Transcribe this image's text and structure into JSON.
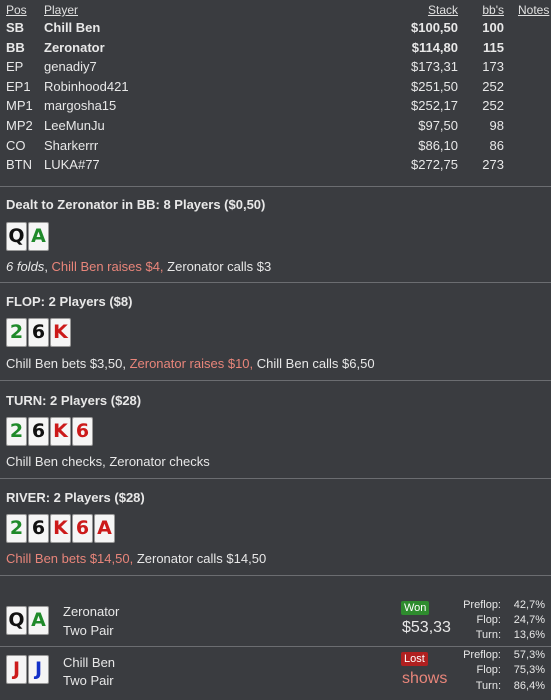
{
  "columns": {
    "pos": "Pos",
    "player": "Player",
    "stack": "Stack",
    "bbs": "bb's",
    "notes": "Notes"
  },
  "players": [
    {
      "pos": "SB",
      "name": "Chill Ben",
      "stack": "$100,50",
      "bb": "100",
      "bold": true
    },
    {
      "pos": "BB",
      "name": "Zeronator",
      "stack": "$114,80",
      "bb": "115",
      "bold": true
    },
    {
      "pos": "EP",
      "name": "genadiy7",
      "stack": "$173,31",
      "bb": "173",
      "bold": false
    },
    {
      "pos": "EP1",
      "name": "Robinhood421",
      "stack": "$251,50",
      "bb": "252",
      "bold": false
    },
    {
      "pos": "MP1",
      "name": "margosha15",
      "stack": "$252,17",
      "bb": "252",
      "bold": false
    },
    {
      "pos": "MP2",
      "name": "LeeMunJu",
      "stack": "$97,50",
      "bb": "98",
      "bold": false
    },
    {
      "pos": "CO",
      "name": "Sharkerrr",
      "stack": "$86,10",
      "bb": "86",
      "bold": false
    },
    {
      "pos": "BTN",
      "name": "LUKA#77",
      "stack": "$272,75",
      "bb": "273",
      "bold": false
    }
  ],
  "preflop": {
    "title": "Dealt to Zeronator in BB: 8 Players ($0,50)",
    "cards": [
      {
        "rank": "Q",
        "suit": "spades"
      },
      {
        "rank": "A",
        "suit": "clubs"
      }
    ],
    "actions": [
      {
        "text": "6 folds",
        "style": "ital"
      },
      {
        "text": ", ",
        "style": "plain"
      },
      {
        "text": "Chill Ben raises $4,",
        "style": "red"
      },
      {
        "text": " Zeronator calls $3",
        "style": "plain"
      }
    ]
  },
  "flop": {
    "title": "FLOP: 2 Players ($8)",
    "cards": [
      {
        "rank": "2",
        "suit": "clubs"
      },
      {
        "rank": "6",
        "suit": "spades"
      },
      {
        "rank": "K",
        "suit": "hearts"
      }
    ],
    "actions": [
      {
        "text": "Chill Ben bets $3,50, ",
        "style": "plain"
      },
      {
        "text": "Zeronator raises $10,",
        "style": "red"
      },
      {
        "text": " Chill Ben calls $6,50",
        "style": "plain"
      }
    ]
  },
  "turn": {
    "title": "TURN: 2 Players ($28)",
    "cards": [
      {
        "rank": "2",
        "suit": "clubs"
      },
      {
        "rank": "6",
        "suit": "spades"
      },
      {
        "rank": "K",
        "suit": "hearts"
      },
      {
        "rank": "6",
        "suit": "hearts"
      }
    ],
    "actions": [
      {
        "text": "Chill Ben checks, Zeronator checks",
        "style": "plain"
      }
    ]
  },
  "river": {
    "title": "RIVER: 2 Players ($28)",
    "cards": [
      {
        "rank": "2",
        "suit": "clubs"
      },
      {
        "rank": "6",
        "suit": "spades"
      },
      {
        "rank": "K",
        "suit": "hearts"
      },
      {
        "rank": "6",
        "suit": "hearts"
      },
      {
        "rank": "A",
        "suit": "hearts"
      }
    ],
    "actions": [
      {
        "text": "Chill Ben bets $14,50,",
        "style": "red"
      },
      {
        "text": " Zeronator calls $14,50",
        "style": "plain"
      }
    ]
  },
  "results": [
    {
      "name": "Zeronator",
      "hand": "Two Pair",
      "badge": "Won",
      "amount": "$53,33",
      "outcome": "won",
      "cards": [
        {
          "rank": "Q",
          "suit": "spades"
        },
        {
          "rank": "A",
          "suit": "clubs"
        }
      ],
      "stats": [
        {
          "label": "Preflop:",
          "value": "42,7%"
        },
        {
          "label": "Flop:",
          "value": "24,7%"
        },
        {
          "label": "Turn:",
          "value": "13,6%"
        }
      ]
    },
    {
      "name": "Chill Ben",
      "hand": "Two Pair",
      "badge": "Lost",
      "amount": "shows",
      "outcome": "lost",
      "cards": [
        {
          "rank": "J",
          "suit": "hearts"
        },
        {
          "rank": "J",
          "suit": "diamonds"
        }
      ],
      "stats": [
        {
          "label": "Preflop:",
          "value": "57,3%"
        },
        {
          "label": "Flop:",
          "value": "75,3%"
        },
        {
          "label": "Turn:",
          "value": "86,4%"
        }
      ]
    }
  ]
}
